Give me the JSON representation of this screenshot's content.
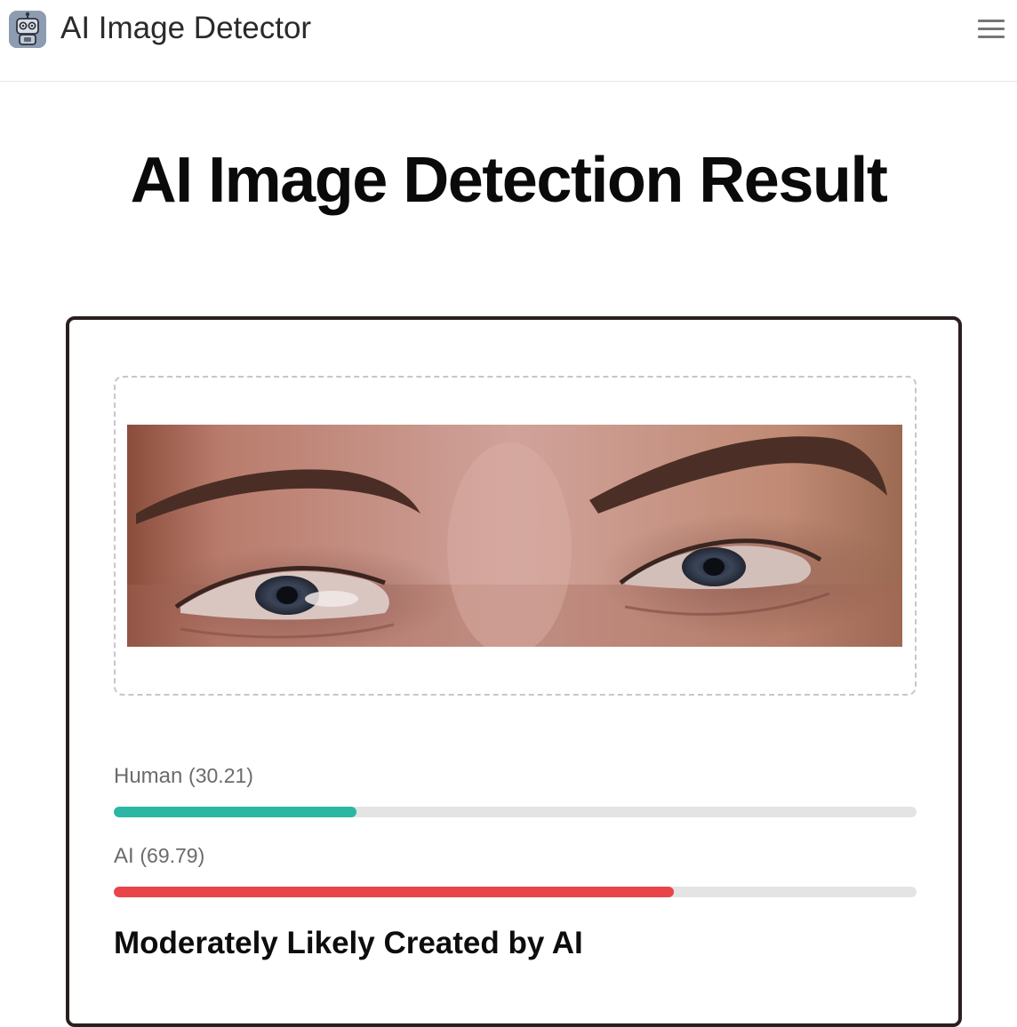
{
  "header": {
    "app_title": "AI Image Detector",
    "logo_icon": "robot-icon",
    "menu_icon": "hamburger-menu-icon"
  },
  "main": {
    "title": "AI Image Detection Result"
  },
  "result": {
    "image_alt": "Uploaded image: close-up of a person's eyes",
    "scores": [
      {
        "name": "Human",
        "value": "30.21",
        "percent": 30.21,
        "color": "#2bb7a3"
      },
      {
        "name": "AI",
        "value": "69.79",
        "percent": 69.79,
        "color": "#e9444a"
      }
    ],
    "verdict": "Moderately Likely Created by AI"
  },
  "colors": {
    "track": "#e4e4e4",
    "card_border": "#2a1f1f"
  }
}
